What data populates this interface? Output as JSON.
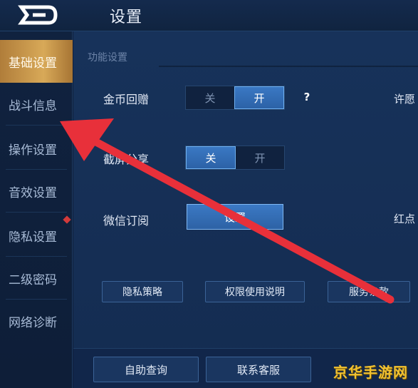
{
  "header": {
    "title": "设置"
  },
  "sidebar": {
    "items": [
      {
        "label": "基础设置",
        "active": true
      },
      {
        "label": "战斗信息"
      },
      {
        "label": "操作设置"
      },
      {
        "label": "音效设置"
      },
      {
        "label": "隐私设置",
        "badge": true
      },
      {
        "label": "二级密码"
      },
      {
        "label": "网络诊断"
      }
    ]
  },
  "main": {
    "section_title": "功能设置",
    "rows": {
      "gold_gift": {
        "label": "金币回赠",
        "off": "关",
        "on": "开",
        "selected": "开"
      },
      "screenshot_share": {
        "label": "截屏分享",
        "off": "关",
        "on": "开",
        "selected": "关"
      },
      "wechat_sub": {
        "label": "微信订阅",
        "button": "设置"
      }
    },
    "help_label": "?",
    "right_label_1": "许愿",
    "right_label_2": "红点",
    "buttons": {
      "privacy_policy": "隐私策略",
      "permission_usage": "权限使用说明",
      "service_terms": "服务条款"
    },
    "bottom": {
      "self_query": "自助查询",
      "contact_service": "联系客服"
    }
  },
  "watermark": "京华手游网",
  "colors": {
    "accent_blue": "#3a78c3",
    "active_gold": "#d8a958",
    "arrow_red": "#e8303a"
  }
}
